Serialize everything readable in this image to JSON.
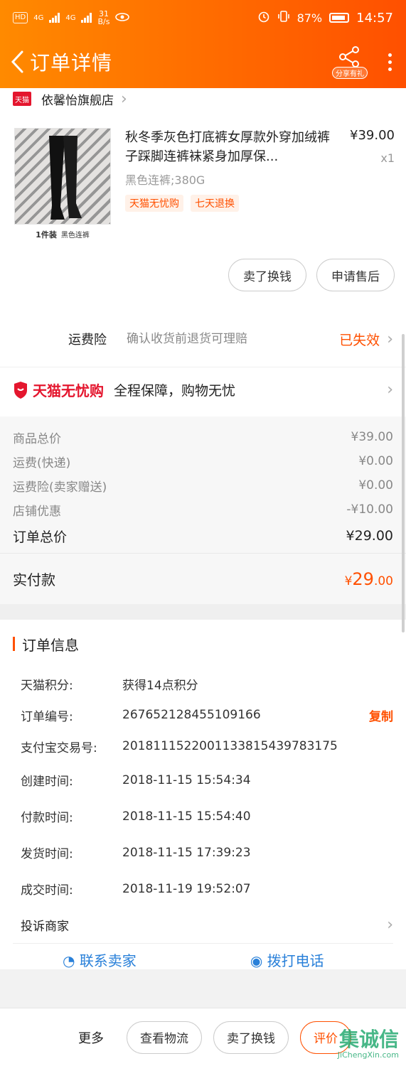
{
  "status_bar": {
    "hd": "HD",
    "net1": "4G",
    "net2": "4G",
    "speed_value": "31",
    "speed_unit": "B/s",
    "battery": "87%",
    "time": "14:57"
  },
  "header": {
    "title": "订单详情",
    "share_label": "分享有礼"
  },
  "shop": {
    "badge": "天猫",
    "name": "依馨怡旗舰店"
  },
  "item": {
    "title": "秋冬季灰色打底裤女厚款外穿加绒裤子踩脚连裤袜紧身加厚保...",
    "sku": "黑色连裤;380G",
    "tags": [
      "天猫无忧购",
      "七天退换"
    ],
    "price": "¥39.00",
    "qty": "x1",
    "thumb_caption_bold": "1件装",
    "thumb_caption": "黑色连裤"
  },
  "item_actions": {
    "sell_label": "卖了换钱",
    "aftersale_label": "申请售后"
  },
  "insurance": {
    "label": "运费险",
    "desc": "确认收货前退货可理赔",
    "status": "已失效"
  },
  "guarantee": {
    "brand": "天猫无忧购",
    "text": "全程保障，购物无忧"
  },
  "prices": {
    "rows": [
      {
        "label": "商品总价",
        "value": "¥39.00"
      },
      {
        "label": "运费(快递)",
        "value": "¥0.00"
      },
      {
        "label": "运费险(卖家赠送)",
        "value": "¥0.00"
      },
      {
        "label": "店铺优惠",
        "value": "-¥10.00"
      }
    ],
    "total_label": "订单总价",
    "total_value": "¥29.00",
    "paid_label": "实付款",
    "paid_currency": "¥",
    "paid_int": "29",
    "paid_dec": ".00"
  },
  "order_info": {
    "title": "订单信息",
    "rows": [
      {
        "label": "天猫积分:",
        "value": "获得14点积分"
      },
      {
        "label": "订单编号:",
        "value": "267652128455109166",
        "action": "复制"
      },
      {
        "label": "支付宝交易号:",
        "value": "2018111522001133815439783175"
      },
      {
        "label": "创建时间:",
        "value": "2018-11-15 15:54:34"
      },
      {
        "label": "付款时间:",
        "value": "2018-11-15 15:54:40"
      },
      {
        "label": "发货时间:",
        "value": "2018-11-15 17:39:23"
      },
      {
        "label": "成交时间:",
        "value": "2018-11-19 19:52:07"
      }
    ],
    "complaint": "投诉商家",
    "contact_seller": "联系卖家",
    "call_phone": "拨打电话"
  },
  "bottom_bar": {
    "more": "更多",
    "logistics": "查看物流",
    "sell": "卖了换钱",
    "review": "评价"
  },
  "watermark": {
    "main": "集诚信",
    "sub": "JiChengXin.com"
  },
  "colors": {
    "accent": "#ff5000",
    "header_start": "#ff8a00",
    "tmall_red": "#e4162e"
  }
}
